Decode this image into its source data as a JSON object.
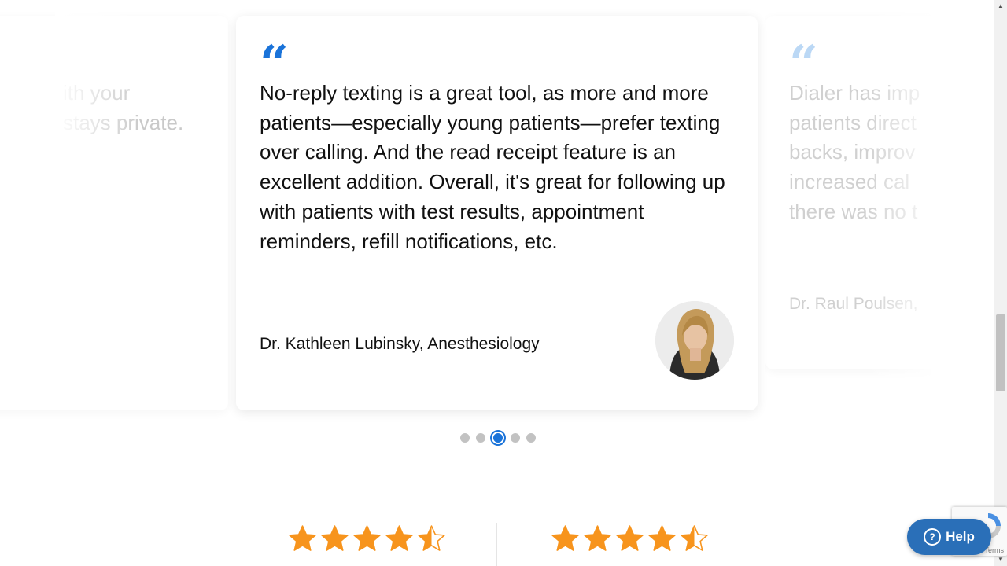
{
  "testimonials": [
    {
      "partial_text": "ith your\nstays private."
    },
    {
      "quote_mark": "“",
      "text": "No-reply texting is a great tool, as more and more patients—especially young patients—prefer texting over calling. And the read receipt feature is an excellent addition. Overall, it's great for following up with patients with test results, appointment reminders, refill notifications, etc.",
      "author": "Dr. Kathleen Lubinsky, Anesthesiology"
    },
    {
      "quote_mark": "“",
      "text": "Dialer has imp\npatients direct\nbacks, improv\nincreased cal\nthere was no t",
      "author": "Dr. Raul Poulsen,"
    }
  ],
  "pagination": {
    "total": 5,
    "active_index": 2
  },
  "ratings": [
    {
      "value": 4.5
    },
    {
      "value": 4.5
    }
  ],
  "colors": {
    "accent": "#1a73d9",
    "star": "#f7941d",
    "help_bg": "#2a6fb8"
  },
  "help": {
    "label": "Help"
  },
  "recaptcha": {
    "terms": "Terms"
  }
}
